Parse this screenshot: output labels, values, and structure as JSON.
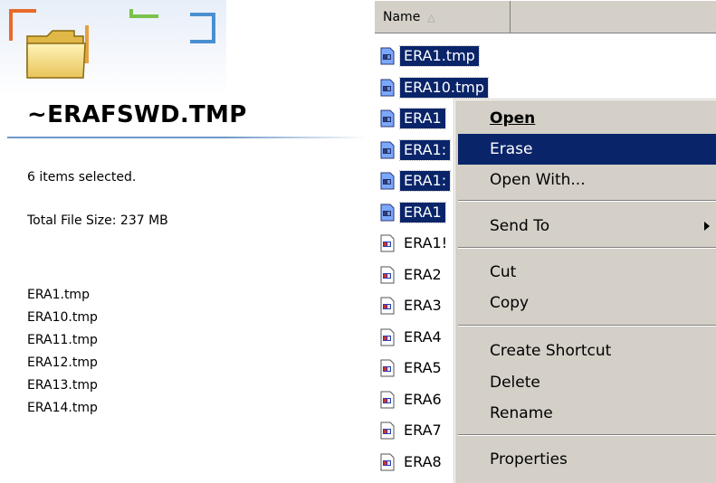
{
  "info": {
    "title": "~ERAFSWD.TMP",
    "selected_count": "6 items selected.",
    "total_size": "Total File Size: 237 MB",
    "selected_files": [
      "ERA1.tmp",
      "ERA10.tmp",
      "ERA11.tmp",
      "ERA12.tmp",
      "ERA13.tmp",
      "ERA14.tmp"
    ]
  },
  "list": {
    "column_name": "Name",
    "sort_icon": "sort-ascending-icon",
    "files": [
      {
        "name": "ERA1.tmp",
        "selected": true
      },
      {
        "name": "ERA10.tmp",
        "selected": true
      },
      {
        "name": "ERA1",
        "selected": true
      },
      {
        "name": "ERA1:",
        "selected": true
      },
      {
        "name": "ERA1:",
        "selected": true
      },
      {
        "name": "ERA1",
        "selected": true
      },
      {
        "name": "ERA1!",
        "selected": false
      },
      {
        "name": "ERA2",
        "selected": false
      },
      {
        "name": "ERA3",
        "selected": false
      },
      {
        "name": "ERA4",
        "selected": false
      },
      {
        "name": "ERA5",
        "selected": false
      },
      {
        "name": "ERA6",
        "selected": false
      },
      {
        "name": "ERA7",
        "selected": false
      },
      {
        "name": "ERA8",
        "selected": false
      }
    ]
  },
  "context_menu": {
    "open": "Open",
    "erase": "Erase",
    "open_with": "Open With...",
    "send_to": "Send To",
    "cut": "Cut",
    "copy": "Copy",
    "create_shortcut": "Create Shortcut",
    "delete": "Delete",
    "rename": "Rename",
    "properties": "Properties"
  },
  "colors": {
    "selection": "#0a246a",
    "menu_bg": "#d4d0c8",
    "header_rule": "#6f97c9"
  }
}
